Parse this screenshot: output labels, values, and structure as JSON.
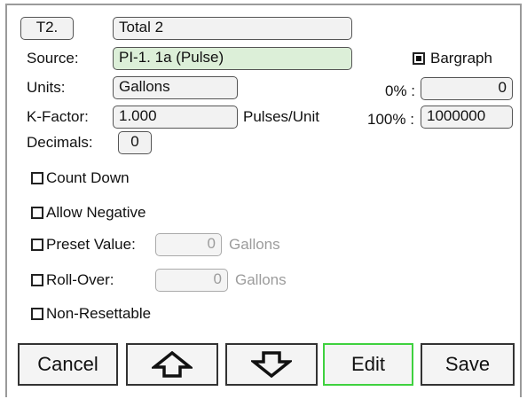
{
  "header": {
    "tag_label": "T2.",
    "name_value": "Total 2"
  },
  "source": {
    "label": "Source:",
    "value": "PI-1. 1a (Pulse)"
  },
  "units": {
    "label": "Units:",
    "value": "Gallons"
  },
  "kfactor": {
    "label": "K-Factor:",
    "value": "1.000",
    "unit": "Pulses/Unit"
  },
  "decimals": {
    "label": "Decimals:",
    "value": "0"
  },
  "bargraph": {
    "label": "Bargraph",
    "checked": true,
    "zero_label": "0% :",
    "zero_value": "0",
    "hundred_label": "100% :",
    "hundred_value": "1000000"
  },
  "options": {
    "count_down": "Count Down",
    "allow_negative": "Allow Negative",
    "preset_label": "Preset Value:",
    "preset_value": "0",
    "preset_unit": "Gallons",
    "rollover_label": "Roll-Over:",
    "rollover_value": "0",
    "rollover_unit": "Gallons",
    "non_resettable": "Non-Resettable"
  },
  "buttons": {
    "cancel": "Cancel",
    "up_icon": "arrow-up-outline-icon",
    "down_icon": "arrow-down-outline-icon",
    "edit": "Edit",
    "save": "Save"
  },
  "colors": {
    "source_bg": "#dcefd8",
    "edit_border": "#3fd13f"
  }
}
